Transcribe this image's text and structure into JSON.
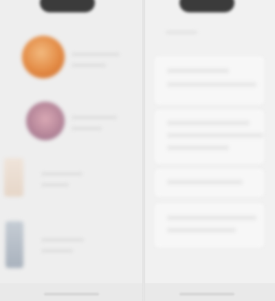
{
  "left_panel": {
    "items": [
      {
        "thumbnail": "orange-round-avatar",
        "color": "#e38a44"
      },
      {
        "thumbnail": "purple-round-avatar",
        "color": "#b7879a"
      },
      {
        "thumbnail": "beige-square-thumbnail",
        "color": "#e6d6c8"
      },
      {
        "thumbnail": "grey-rect-thumbnail",
        "color": "#a9b2bd"
      }
    ]
  },
  "right_panel": {
    "cards": [
      {
        "icon": "placeholder"
      },
      {
        "icon": "placeholder"
      },
      {
        "icon": "placeholder"
      },
      {
        "icon": "placeholder"
      }
    ]
  }
}
